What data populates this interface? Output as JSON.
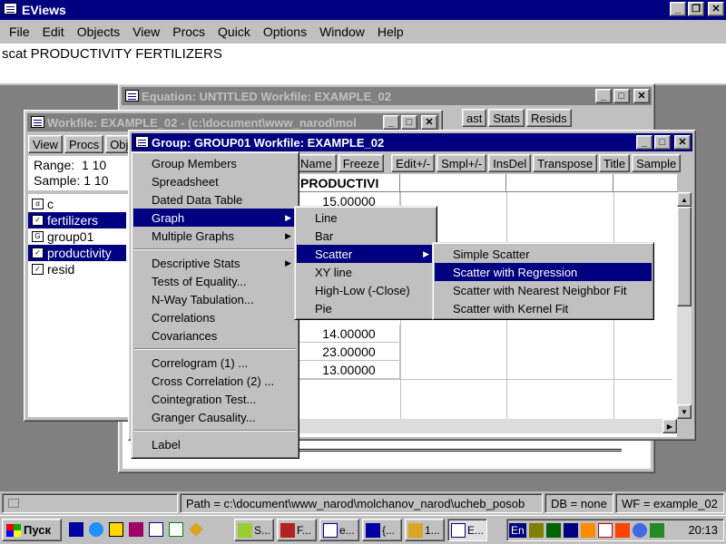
{
  "app": {
    "title": "EViews"
  },
  "menubar": {
    "items": [
      "File",
      "Edit",
      "Objects",
      "View",
      "Procs",
      "Quick",
      "Options",
      "Window",
      "Help"
    ]
  },
  "command": {
    "text": "scat PRODUCTIVITY FERTILIZERS"
  },
  "equation_window": {
    "title": "Equation: UNTITLED   Workfile: EXAMPLE_02",
    "toolbar": [
      "ast",
      "Stats",
      "Resids"
    ]
  },
  "workfile_window": {
    "title": "Workfile: EXAMPLE_02 - (c:\\document\\www_narod\\mol",
    "toolbar": [
      "View",
      "Procs",
      "Obje"
    ],
    "range_label": "Range:",
    "range_value": "1 10",
    "sample_label": "Sample:",
    "sample_value": "1 10",
    "objects": [
      {
        "badge": "α",
        "name": "c"
      },
      {
        "badge": "✓",
        "name": "fertilizers"
      },
      {
        "badge": "G",
        "name": "group01"
      },
      {
        "badge": "✓",
        "name": "productivity"
      },
      {
        "badge": "✓",
        "name": "resid"
      }
    ]
  },
  "group_window": {
    "title": "Group: GROUP01   Workfile: EXAMPLE_02",
    "toolbar": [
      "Name",
      "Freeze",
      "Edit+/-",
      "Smpl+/-",
      "InsDel",
      "Transpose",
      "Title",
      "Sample"
    ],
    "column_header": "PRODUCTIVI",
    "values": [
      "15.00000",
      "14.00000",
      "23.00000",
      "13.00000"
    ]
  },
  "view_menu": {
    "group1": [
      "Group Members",
      "Spreadsheet",
      "Dated Data Table",
      "Graph",
      "Multiple Graphs"
    ],
    "group2": [
      "Descriptive Stats",
      "Tests of Equality...",
      "N-Way Tabulation...",
      "Correlations",
      "Covariances"
    ],
    "group3": [
      "Correlogram (1) ...",
      "Cross Correlation (2) ...",
      "Cointegration Test...",
      "Granger Causality..."
    ],
    "group4": [
      "Label"
    ]
  },
  "graph_menu": {
    "items": [
      "Line",
      "Bar",
      "Scatter",
      "XY line",
      "High-Low (-Close)",
      "Pie"
    ]
  },
  "scatter_menu": {
    "items": [
      "Simple Scatter",
      "Scatter with Regression",
      "Scatter with Nearest Neighbor Fit",
      "Scatter with Kernel Fit"
    ]
  },
  "statusbar": {
    "path": "Path = c:\\document\\www_narod\\molchanov_narod\\ucheb_posob",
    "db": "DB = none",
    "wf": "WF = example_02"
  },
  "taskbar": {
    "start": "Пуск",
    "tasks": [
      "S...",
      "F...",
      "e...",
      "{...",
      "1...",
      "E..."
    ],
    "lang": "En",
    "clock": "20:13"
  },
  "colors": {
    "titlebar_active": "#000080",
    "titlebar_inactive": "#808080",
    "face": "#c0c0c0"
  }
}
